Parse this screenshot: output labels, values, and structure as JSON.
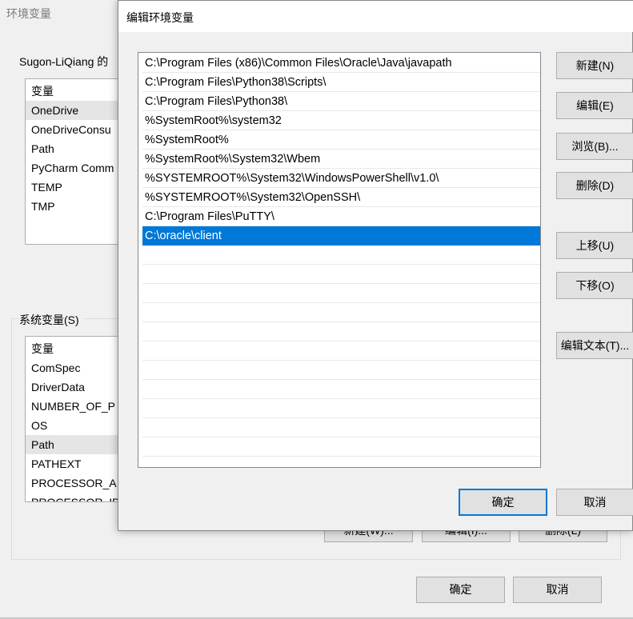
{
  "background_window": {
    "title": "环境变量",
    "user_section": {
      "label": "Sugon-LiQiang 的",
      "header": "变量",
      "rows": [
        "OneDrive",
        "OneDriveConsu",
        "Path",
        "PyCharm Comm",
        "TEMP",
        "TMP"
      ],
      "selected_index": 0
    },
    "system_section": {
      "label": "系统变量(S)",
      "header": "变量",
      "rows": [
        "ComSpec",
        "DriverData",
        "NUMBER_OF_P",
        "OS",
        "Path",
        "PATHEXT",
        "PROCESSOR_A",
        "PROCESSOR_ID"
      ],
      "selected_index": 4
    },
    "system_buttons": {
      "new": "新建(W)...",
      "edit": "编辑(I)...",
      "delete": "删除(L)"
    },
    "footer": {
      "ok": "确定",
      "cancel": "取消"
    }
  },
  "dialog": {
    "title": "编辑环境变量",
    "paths": [
      "C:\\Program Files (x86)\\Common Files\\Oracle\\Java\\javapath",
      "C:\\Program Files\\Python38\\Scripts\\",
      "C:\\Program Files\\Python38\\",
      "%SystemRoot%\\system32",
      "%SystemRoot%",
      "%SystemRoot%\\System32\\Wbem",
      "%SYSTEMROOT%\\System32\\WindowsPowerShell\\v1.0\\",
      "%SYSTEMROOT%\\System32\\OpenSSH\\",
      "C:\\Program Files\\PuTTY\\",
      "C:\\oracle\\client"
    ],
    "selected_index": 9,
    "buttons": {
      "new": "新建(N)",
      "edit": "编辑(E)",
      "browse": "浏览(B)...",
      "delete": "删除(D)",
      "move_up": "上移(U)",
      "move_down": "下移(O)",
      "edit_text": "编辑文本(T)..."
    },
    "footer": {
      "ok": "确定",
      "cancel": "取消"
    },
    "accent_color": "#0078d7"
  }
}
